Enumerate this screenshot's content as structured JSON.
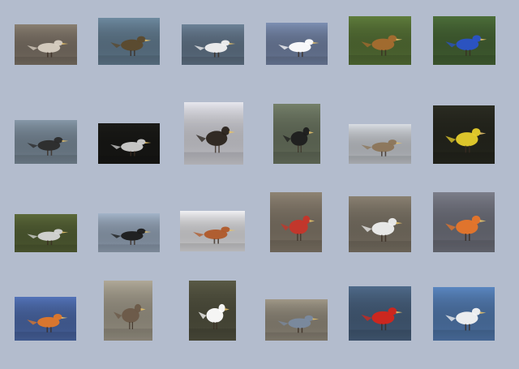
{
  "gallery": {
    "items": [
      {
        "icon": "pebble-beach-bird-image",
        "bg": "#8a7f72",
        "accent": "#d8cfc2"
      },
      {
        "icon": "duck-on-water-image",
        "bg": "#6e8aa0",
        "accent": "#5c4a2c"
      },
      {
        "icon": "egret-on-rock-image",
        "bg": "#6d8298",
        "accent": "#f1f1f1"
      },
      {
        "icon": "avocet-on-water-image",
        "bg": "#7d8fb3",
        "accent": "#ffffff"
      },
      {
        "icon": "thrasher-on-rocks-image",
        "bg": "#5f7d3c",
        "accent": "#a66b2f"
      },
      {
        "icon": "indigo-bunting-image",
        "bg": "#4d6f3a",
        "accent": "#2a53c8"
      },
      {
        "icon": "long-tailed-duck-image",
        "bg": "#8698a8",
        "accent": "#2b2b2b"
      },
      {
        "icon": "black-tern-image",
        "bg": "#1b1b18",
        "accent": "#cfcfcf"
      },
      {
        "icon": "cormorant-calling-image",
        "bg": "#e7e7ee",
        "accent": "#2a231c"
      },
      {
        "icon": "downy-woodpecker-image",
        "bg": "#75806a",
        "accent": "#1d1d1d"
      },
      {
        "icon": "ground-sparrow-image",
        "bg": "#d9dde3",
        "accent": "#8c7558"
      },
      {
        "icon": "goldfinch-on-branch-image",
        "bg": "#2b2c22",
        "accent": "#e7cf2c"
      },
      {
        "icon": "gull-on-pier-image",
        "bg": "#5c6a3a",
        "accent": "#d6d6d6"
      },
      {
        "icon": "crow-on-snow-image",
        "bg": "#a3b4c9",
        "accent": "#1b1b1b"
      },
      {
        "icon": "towhee-in-snow-image",
        "bg": "#f1f1f4",
        "accent": "#b05a2a"
      },
      {
        "icon": "red-bellied-woodpecker-image",
        "bg": "#8f8474",
        "accent": "#c7352a"
      },
      {
        "icon": "plover-on-sand-image",
        "bg": "#8a8172",
        "accent": "#eeeeee"
      },
      {
        "icon": "puffin-on-cliff-image",
        "bg": "#7c7e8a",
        "accent": "#e7752a"
      },
      {
        "icon": "redstart-on-branch-image",
        "bg": "#5373b8",
        "accent": "#e2782a"
      },
      {
        "icon": "sandpiper-on-rock-image",
        "bg": "#b0a998",
        "accent": "#6b5a48"
      },
      {
        "icon": "hairy-woodpecker-image",
        "bg": "#5a5a46",
        "accent": "#ffffff"
      },
      {
        "icon": "nuthatch-on-twig-image",
        "bg": "#a09888",
        "accent": "#7a8aa0"
      },
      {
        "icon": "scarlet-tanager-image",
        "bg": "#4f6a8a",
        "accent": "#d4251b"
      },
      {
        "icon": "tern-in-flight-image",
        "bg": "#5a86c0",
        "accent": "#f4f4f4"
      }
    ]
  }
}
